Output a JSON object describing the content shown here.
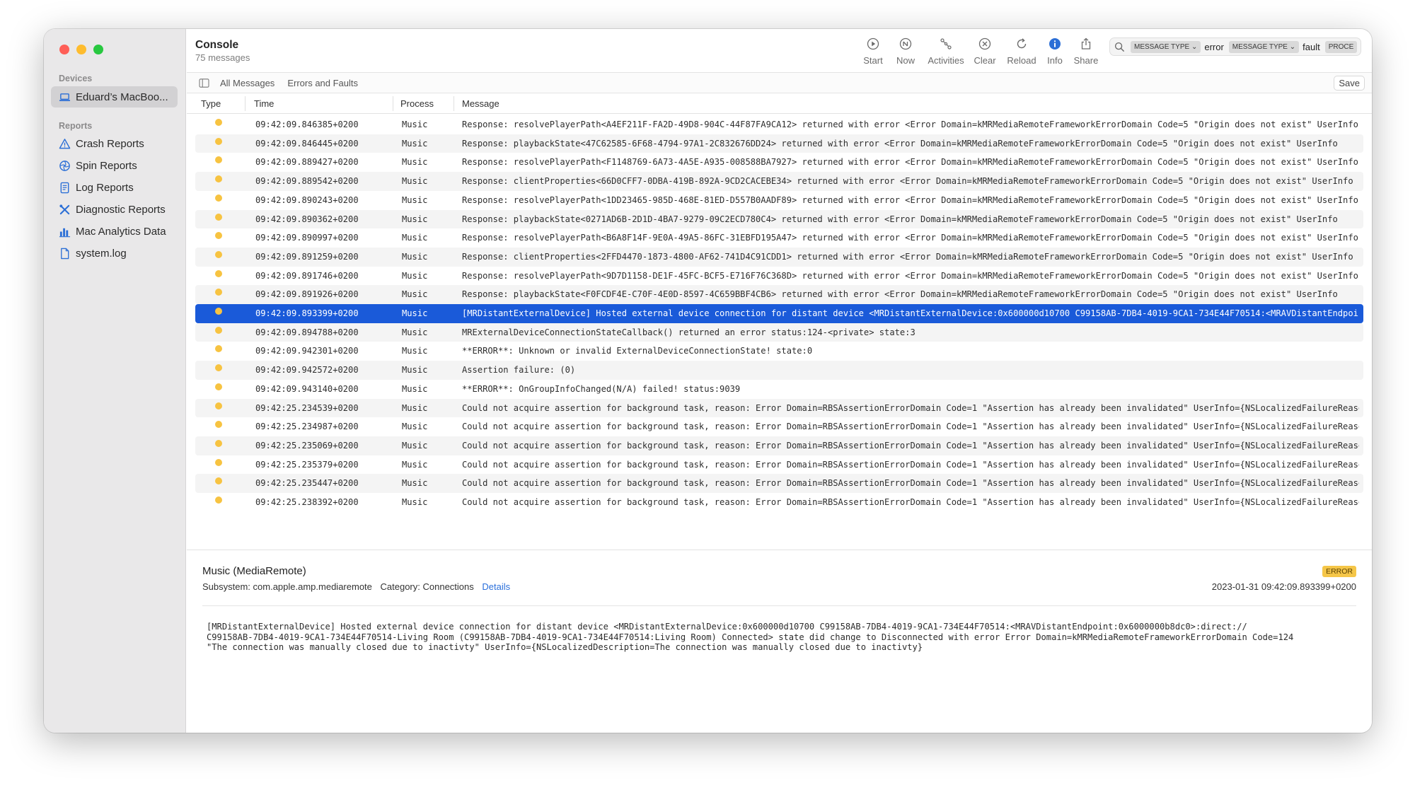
{
  "window": {
    "title": "Console",
    "subtitle": "75 messages"
  },
  "sidebar": {
    "devices_header": "Devices",
    "device_name": "Eduard’s MacBoo...",
    "reports_header": "Reports",
    "items": [
      {
        "label": "Crash Reports",
        "icon": "warning-triangle-icon"
      },
      {
        "label": "Spin Reports",
        "icon": "spin-icon"
      },
      {
        "label": "Log Reports",
        "icon": "document-icon"
      },
      {
        "label": "Diagnostic Reports",
        "icon": "tools-icon"
      },
      {
        "label": "Mac Analytics Data",
        "icon": "bar-chart-icon"
      },
      {
        "label": "system.log",
        "icon": "file-icon"
      }
    ]
  },
  "toolbar": {
    "start": "Start",
    "now": "Now",
    "activities": "Activities",
    "clear": "Clear",
    "reload": "Reload",
    "info": "Info",
    "share": "Share"
  },
  "search": {
    "token1": "MESSAGE TYPE ⌄",
    "value1": "error",
    "token2": "MESSAGE TYPE ⌄",
    "value2": "fault",
    "token3": "PROCE"
  },
  "filters": {
    "all": "All Messages",
    "errors": "Errors and Faults",
    "save": "Save"
  },
  "columns": {
    "type": "Type",
    "time": "Time",
    "process": "Process",
    "message": "Message"
  },
  "rows": [
    {
      "time": "09:42:09.846385+0200",
      "process": "Music",
      "message": "Response: resolvePlayerPath<A4EF211F-FA2D-49D8-904C-44F87FA9CA12> returned with error <Error Domain=kMRMediaRemoteFrameworkErrorDomain Code=5 \"Origin does not exist\" UserInfo"
    },
    {
      "time": "09:42:09.846445+0200",
      "process": "Music",
      "message": "Response: playbackState<47C62585-6F68-4794-97A1-2C832676DD24> returned with error <Error Domain=kMRMediaRemoteFrameworkErrorDomain Code=5 \"Origin does not exist\" UserInfo"
    },
    {
      "time": "09:42:09.889427+0200",
      "process": "Music",
      "message": "Response: resolvePlayerPath<F1148769-6A73-4A5E-A935-008588BA7927> returned with error <Error Domain=kMRMediaRemoteFrameworkErrorDomain Code=5 \"Origin does not exist\" UserInfo"
    },
    {
      "time": "09:42:09.889542+0200",
      "process": "Music",
      "message": "Response: clientProperties<66D0CFF7-0DBA-419B-892A-9CD2CACEBE34> returned with error <Error Domain=kMRMediaRemoteFrameworkErrorDomain Code=5 \"Origin does not exist\" UserInfo"
    },
    {
      "time": "09:42:09.890243+0200",
      "process": "Music",
      "message": "Response: resolvePlayerPath<1DD23465-985D-468E-81ED-D557B0AADF89> returned with error <Error Domain=kMRMediaRemoteFrameworkErrorDomain Code=5 \"Origin does not exist\" UserInfo"
    },
    {
      "time": "09:42:09.890362+0200",
      "process": "Music",
      "message": "Response: playbackState<0271AD6B-2D1D-4BA7-9279-09C2ECD780C4> returned with error <Error Domain=kMRMediaRemoteFrameworkErrorDomain Code=5 \"Origin does not exist\" UserInfo"
    },
    {
      "time": "09:42:09.890997+0200",
      "process": "Music",
      "message": "Response: resolvePlayerPath<B6A8F14F-9E0A-49A5-86FC-31EBFD195A47> returned with error <Error Domain=kMRMediaRemoteFrameworkErrorDomain Code=5 \"Origin does not exist\" UserInfo"
    },
    {
      "time": "09:42:09.891259+0200",
      "process": "Music",
      "message": "Response: clientProperties<2FFD4470-1873-4800-AF62-741D4C91CDD1> returned with error <Error Domain=kMRMediaRemoteFrameworkErrorDomain Code=5 \"Origin does not exist\" UserInfo"
    },
    {
      "time": "09:42:09.891746+0200",
      "process": "Music",
      "message": "Response: resolvePlayerPath<9D7D1158-DE1F-45FC-BCF5-E716F76C368D> returned with error <Error Domain=kMRMediaRemoteFrameworkErrorDomain Code=5 \"Origin does not exist\" UserInfo"
    },
    {
      "time": "09:42:09.891926+0200",
      "process": "Music",
      "message": "Response: playbackState<F0FCDF4E-C70F-4E0D-8597-4C659BBF4CB6> returned with error <Error Domain=kMRMediaRemoteFrameworkErrorDomain Code=5 \"Origin does not exist\" UserInfo"
    },
    {
      "time": "09:42:09.893399+0200",
      "process": "Music",
      "message": "[MRDistantExternalDevice] Hosted external device connection for distant device <MRDistantExternalDevice:0x600000d10700 C99158AB-7DB4-4019-9CA1-734E44F70514:<MRAVDistantEndpoint"
    },
    {
      "time": "09:42:09.894788+0200",
      "process": "Music",
      "message": "MRExternalDeviceConnectionStateCallback() returned an error status:124-<private> state:3"
    },
    {
      "time": "09:42:09.942301+0200",
      "process": "Music",
      "message": "**ERROR**: Unknown or invalid ExternalDeviceConnectionState! state:0"
    },
    {
      "time": "09:42:09.942572+0200",
      "process": "Music",
      "message": "Assertion failure: (0)"
    },
    {
      "time": "09:42:09.943140+0200",
      "process": "Music",
      "message": "**ERROR**: OnGroupInfoChanged(N/A) failed! status:9039"
    },
    {
      "time": "09:42:25.234539+0200",
      "process": "Music",
      "message": "Could not acquire assertion for background task, reason: Error Domain=RBSAssertionErrorDomain Code=1 \"Assertion has already been invalidated\" UserInfo={NSLocalizedFailureReason"
    },
    {
      "time": "09:42:25.234987+0200",
      "process": "Music",
      "message": "Could not acquire assertion for background task, reason: Error Domain=RBSAssertionErrorDomain Code=1 \"Assertion has already been invalidated\" UserInfo={NSLocalizedFailureReason"
    },
    {
      "time": "09:42:25.235069+0200",
      "process": "Music",
      "message": "Could not acquire assertion for background task, reason: Error Domain=RBSAssertionErrorDomain Code=1 \"Assertion has already been invalidated\" UserInfo={NSLocalizedFailureReason"
    },
    {
      "time": "09:42:25.235379+0200",
      "process": "Music",
      "message": "Could not acquire assertion for background task, reason: Error Domain=RBSAssertionErrorDomain Code=1 \"Assertion has already been invalidated\" UserInfo={NSLocalizedFailureReason"
    },
    {
      "time": "09:42:25.235447+0200",
      "process": "Music",
      "message": "Could not acquire assertion for background task, reason: Error Domain=RBSAssertionErrorDomain Code=1 \"Assertion has already been invalidated\" UserInfo={NSLocalizedFailureReason"
    },
    {
      "time": "09:42:25.238392+0200",
      "process": "Music",
      "message": "Could not acquire assertion for background task, reason: Error Domain=RBSAssertionErrorDomain Code=1 \"Assertion has already been invalidated\" UserInfo={NSLocalizedFailureReason"
    }
  ],
  "selected_row": 10,
  "detail": {
    "title": "Music (MediaRemote)",
    "subsystem": "Subsystem: com.apple.amp.mediaremote",
    "category": "Category: Connections",
    "details_link": "Details",
    "badge": "ERROR",
    "date": "2023-01-31 09:42:09.893399+0200",
    "message_lines": [
      "[MRDistantExternalDevice] Hosted external device connection for distant device <MRDistantExternalDevice:0x600000d10700 C99158AB-7DB4-4019-9CA1-734E44F70514:<MRAVDistantEndpoint:0x6000000b8dc0>:direct://",
      "C99158AB-7DB4-4019-9CA1-734E44F70514-Living Room (C99158AB-7DB4-4019-9CA1-734E44F70514:Living Room) Connected> state did change to Disconnected with error Error Domain=kMRMediaRemoteFrameworkErrorDomain Code=124",
      "\"The connection was manually closed due to inactivty\" UserInfo={NSLocalizedDescription=The connection was manually closed due to inactivty}"
    ]
  },
  "colors": {
    "selection": "#1a5ad9",
    "dot": "#f7c341",
    "link": "#2a6fdb",
    "badge": "#f5c648"
  }
}
